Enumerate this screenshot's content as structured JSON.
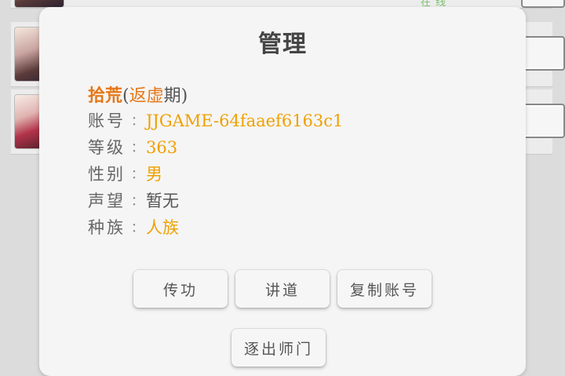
{
  "background": {
    "online_text": "在线"
  },
  "dialog": {
    "title": "管理",
    "player": {
      "name": "拾荒",
      "paren_open": "(",
      "realm": "返虚",
      "stage": "期",
      "paren_close": ")"
    },
    "fields": [
      {
        "label": "账号",
        "value": "JJGAME-64faaef6163c1"
      },
      {
        "label": "等级",
        "value": "363"
      },
      {
        "label": "性别",
        "value": "男"
      },
      {
        "label": "声望",
        "value": "暂无"
      },
      {
        "label": "种族",
        "value": "人族"
      }
    ],
    "colon": "：",
    "buttons": {
      "transfer_skill": "传功",
      "preach": "讲道",
      "copy_account": "复制账号",
      "expel": "逐出师门"
    }
  }
}
